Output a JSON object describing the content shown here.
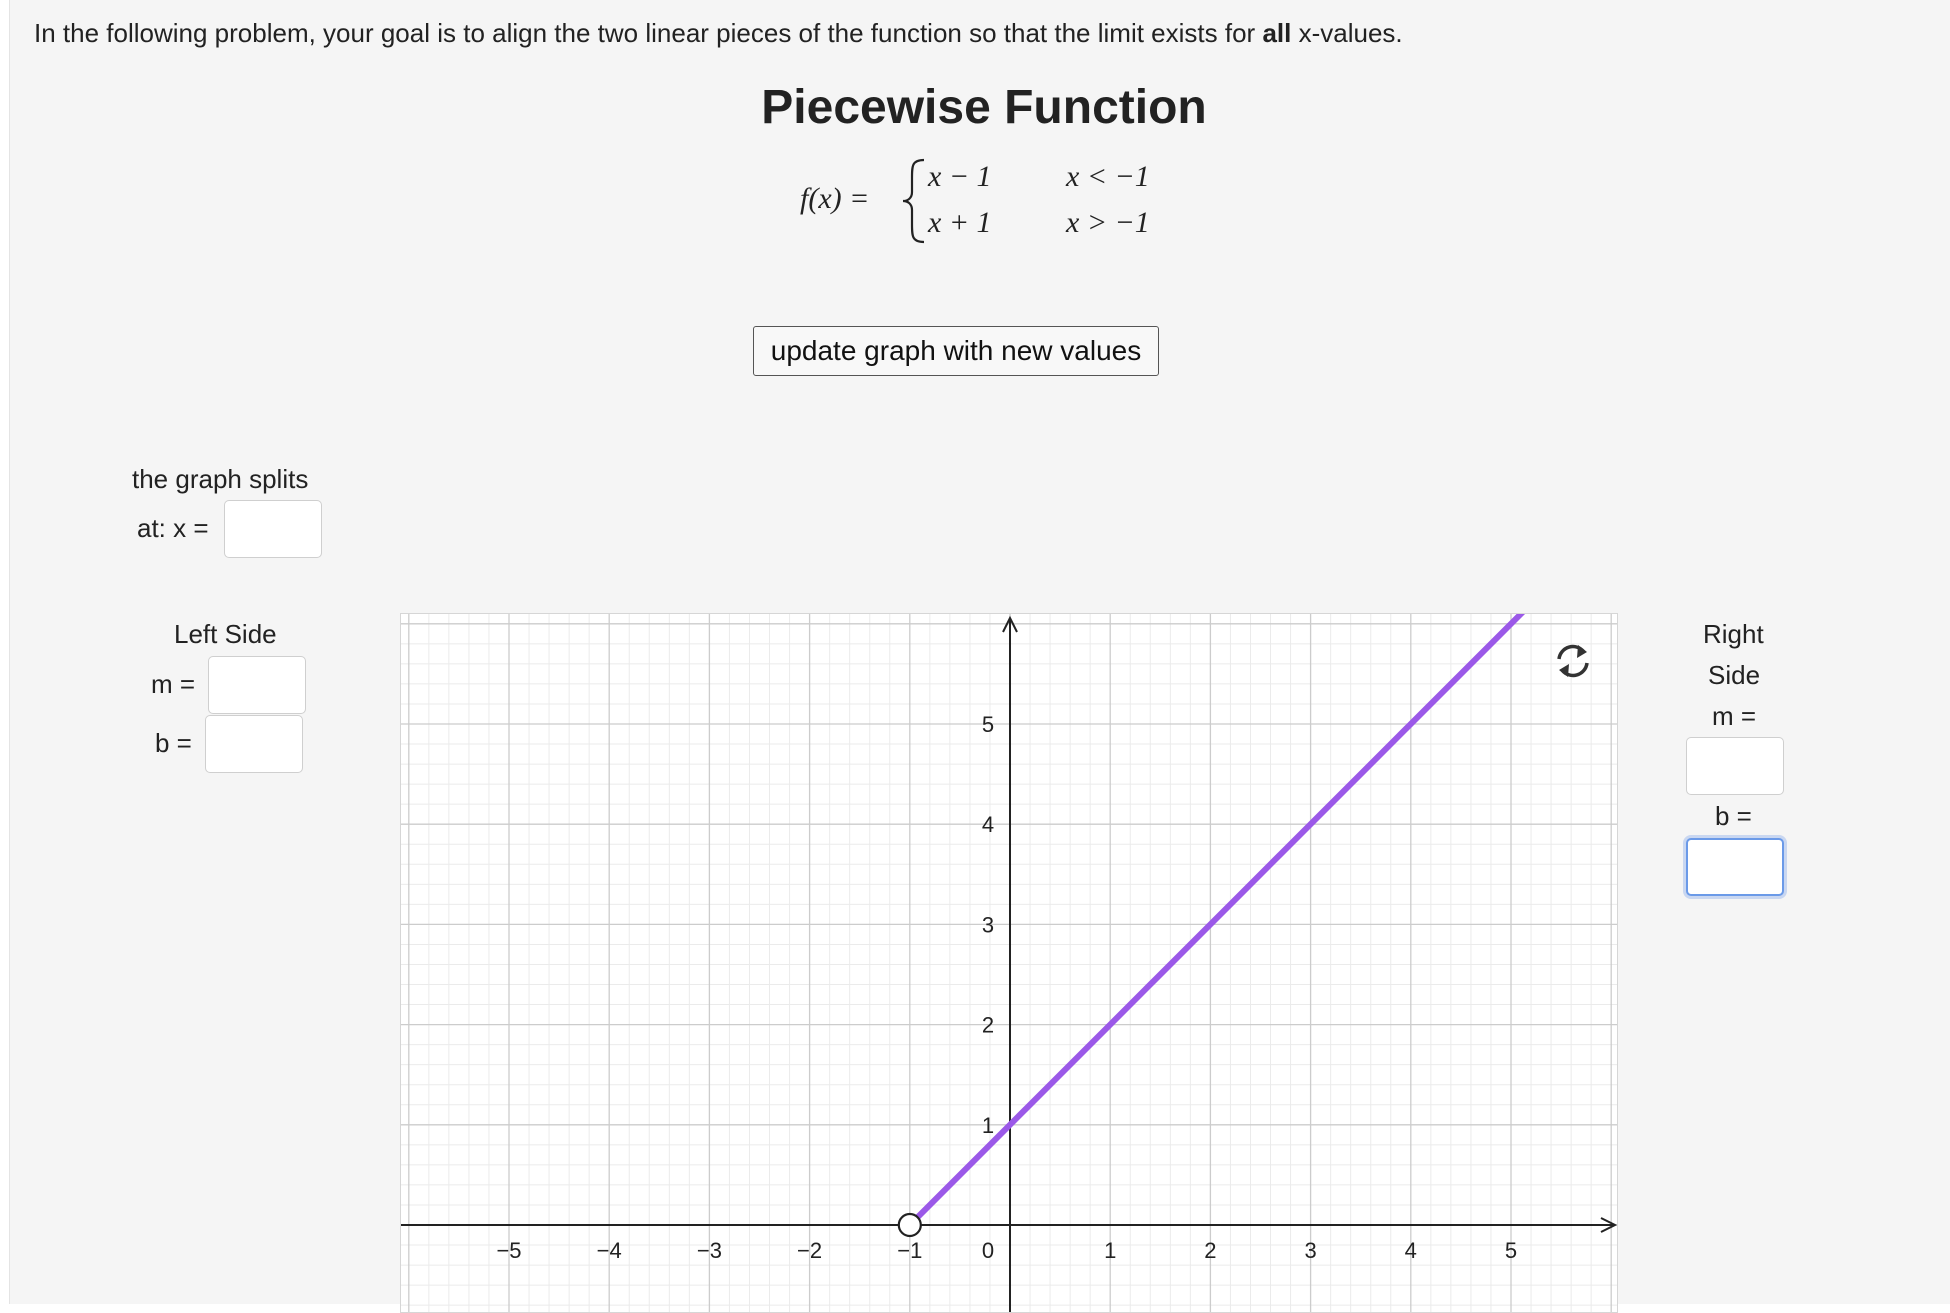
{
  "instructions": {
    "before": "In the following problem, your goal is to align the two linear pieces of the function so that the limit exists for ",
    "bold": "all",
    "after": " x-values."
  },
  "title": "Piecewise Function",
  "function": {
    "lhs": "f(x) =",
    "pieces": [
      {
        "expr": "x − 1",
        "cond": "x < −1"
      },
      {
        "expr": "x + 1",
        "cond": "x > −1"
      }
    ]
  },
  "update_button": "update graph with new values",
  "split": {
    "label_line1": "the graph splits",
    "label_line2": "at: x =",
    "value": ""
  },
  "left_side": {
    "heading": "Left Side",
    "m_label": "m =",
    "m_value": "",
    "b_label": "b =",
    "b_value": ""
  },
  "right_side": {
    "heading_line1": "Right",
    "heading_line2": "Side",
    "m_label": "m =",
    "m_value": "",
    "b_label": "b =",
    "b_value": ""
  },
  "colors": {
    "line": "#9b59e8",
    "grid_major": "#cccccc",
    "grid_minor": "#ebebeb",
    "axis": "#222222",
    "focus": "#6b9ae8"
  },
  "icons": {
    "reset": "refresh-icon"
  },
  "chart_data": {
    "type": "line",
    "x_ticks": [
      "−5",
      "−4",
      "−3",
      "−2",
      "−1",
      "0",
      "1",
      "2",
      "3",
      "4",
      "5"
    ],
    "x_tick_values": [
      -5,
      -4,
      -3,
      -2,
      -1,
      0,
      1,
      2,
      3,
      4,
      5
    ],
    "y_ticks": [
      "1",
      "2",
      "3",
      "4",
      "5"
    ],
    "y_tick_values": [
      1,
      2,
      3,
      4,
      5
    ],
    "xlim": [
      -6.1,
      6.1
    ],
    "ylim": [
      -0.8,
      6.1
    ],
    "grid": true,
    "series": [
      {
        "segment": {
          "x1": -1,
          "y1": 0,
          "x2": 6.1,
          "y2": 7.1
        },
        "open_endpoint": {
          "x": -1,
          "y": 0
        }
      }
    ]
  }
}
